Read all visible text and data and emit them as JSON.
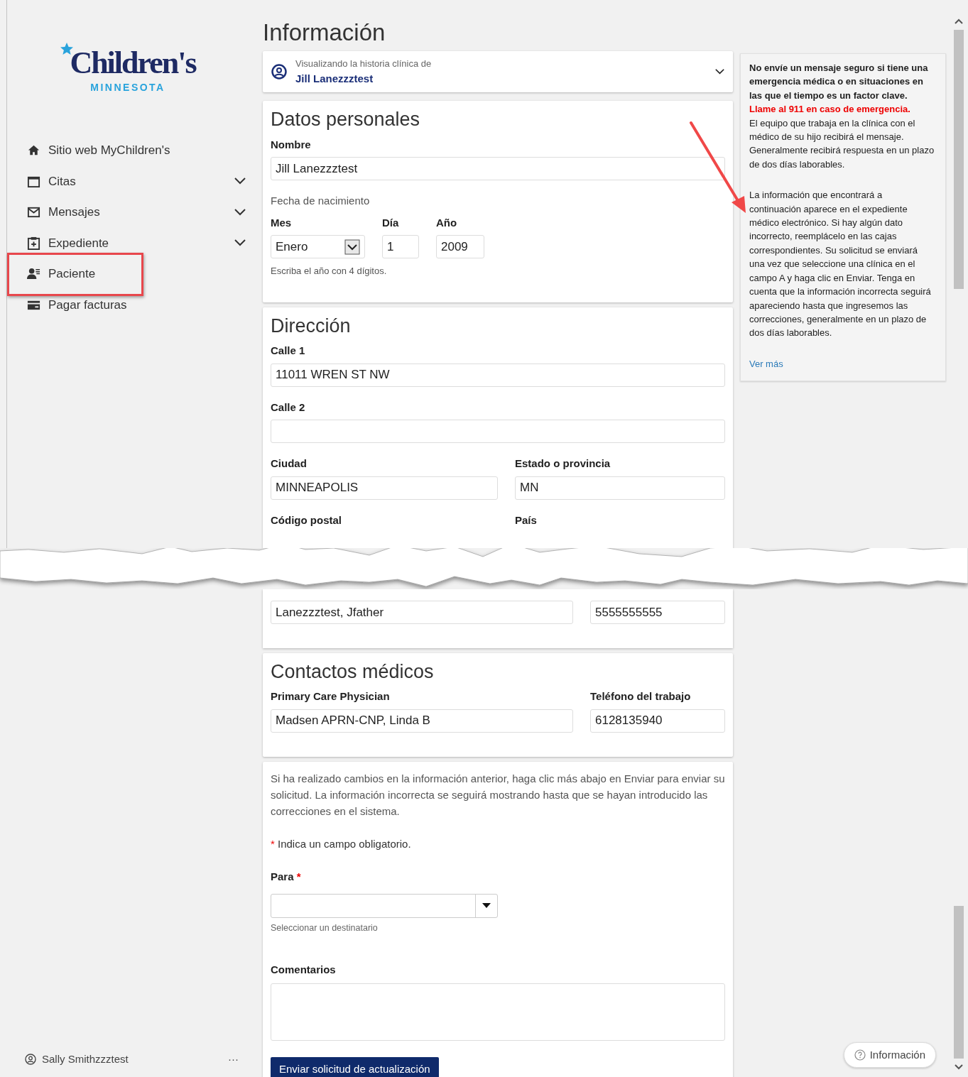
{
  "sidebar": {
    "logo": {
      "name": "Children's",
      "region": "MINNESOTA"
    },
    "nav": [
      {
        "label": "Sitio web MyChildren's",
        "expandable": false,
        "highlighted": false
      },
      {
        "label": "Citas",
        "expandable": true,
        "highlighted": false
      },
      {
        "label": "Mensajes",
        "expandable": true,
        "highlighted": false
      },
      {
        "label": "Expediente",
        "expandable": true,
        "highlighted": false
      },
      {
        "label": "Paciente",
        "expandable": false,
        "highlighted": true
      },
      {
        "label": "Pagar facturas",
        "expandable": false,
        "highlighted": false
      }
    ],
    "user": {
      "name": "Sally Smithzzztest",
      "menu": "···"
    }
  },
  "page_title": "Información",
  "patient_selector": {
    "caption": "Visualizando la historia clínica de",
    "name": "Jill Lanezzztest"
  },
  "personal": {
    "title": "Datos personales",
    "name_label": "Nombre",
    "name_value": "Jill Lanezzztest",
    "dob_label": "Fecha de nacimiento",
    "month_label": "Mes",
    "month_value": "Enero",
    "day_label": "Día",
    "day_value": "1",
    "year_label": "Año",
    "year_value": "2009",
    "hint": "Escriba el año con 4 dígitos."
  },
  "address": {
    "title": "Dirección",
    "rows": [
      [
        {
          "kind": "field",
          "label": "Calle 1",
          "value": "11011 WREN ST NW"
        }
      ],
      [
        {
          "kind": "field",
          "label": "Calle 2"
        }
      ],
      [
        {
          "kind": "field",
          "label": "Ciudad",
          "value": "MINNEAPOLIS"
        },
        {
          "kind": "field",
          "label": "Estado o provincia",
          "value": "MN"
        }
      ],
      [
        {
          "kind": "cut",
          "label": "Código postal"
        },
        {
          "kind": "cut",
          "label": "País"
        }
      ]
    ]
  },
  "guardian": {
    "fields": [
      {
        "value": "Lanezzztest, Jfather"
      },
      {
        "value": "5555555555"
      }
    ]
  },
  "medical_contacts": {
    "title": "Contactos médicos",
    "fields": [
      {
        "label": "Primary Care Physician",
        "value": "Madsen APRN-CNP, Linda B"
      },
      {
        "label": "Teléfono del trabajo",
        "value": "6128135940"
      }
    ]
  },
  "request": {
    "intro": "Si ha realizado cambios en la información anterior, haga clic más abajo en Enviar para enviar su solicitud. La información incorrecta se seguirá mostrando hasta que se hayan introducido las correcciones en el sistema.",
    "required_mark": "*",
    "required_note": "Indica un campo obligatorio.",
    "to_label": "Para",
    "to_required": true,
    "to_hint": "Seleccionar un destinatario",
    "comments_label": "Comentarios",
    "submit": "Enviar solicitud de actualización"
  },
  "notice": {
    "warning": "No envíe un mensaje seguro si tiene una emergencia médica o en situaciones en las que el tiempo es un factor clave.",
    "emergency": "Llame al 911 en caso de emergencia.",
    "body": "El equipo que trabaja en la clínica con el médico de su hijo recibirá el mensaje. Generalmente recibirá respuesta en un plazo de dos días laborables.",
    "info": "La información que encontrará a continuación aparece en el expediente médico electrónico. Si hay algún dato incorrecto, reemplácelo en las cajas correspondientes. Su solicitud se enviará una vez que seleccione una clínica en el campo A y haga clic en Enviar. Tenga en cuenta que la información incorrecta seguirá apareciendo hasta que ingresemos las correcciones, generalmente en un plazo de dos días laborables.",
    "more": "Ver más"
  },
  "help_button": "Información"
}
